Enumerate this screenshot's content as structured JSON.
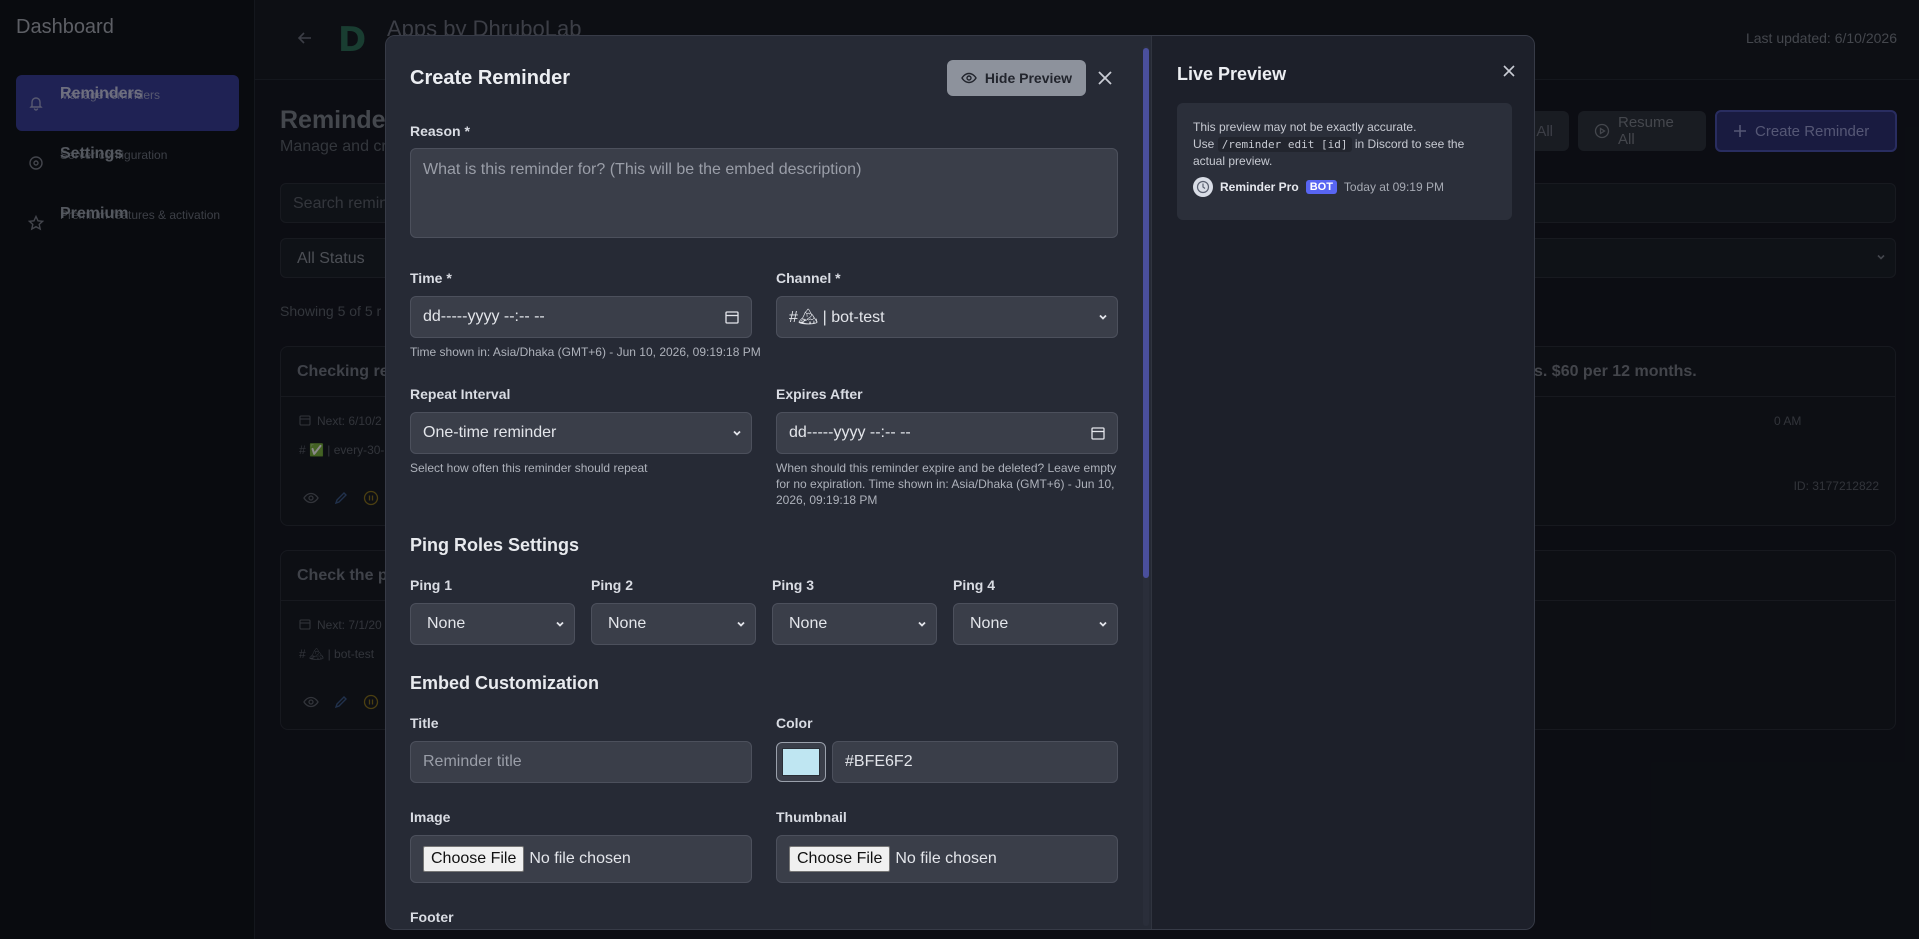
{
  "sidebar": {
    "title": "Dashboard",
    "items": [
      {
        "label": "Reminders",
        "sub": "Manage reminders",
        "icon": "bell-icon"
      },
      {
        "label": "Settings",
        "sub": "Server configuration",
        "icon": "gear-icon"
      },
      {
        "label": "Premium",
        "sub": "Premium features & activation",
        "icon": "star-icon"
      }
    ]
  },
  "header": {
    "logo": "D",
    "title": "Apps by DhruboLab",
    "last_updated": "Last updated: 6/10/2026"
  },
  "page": {
    "title": "Reminder",
    "subtitle": "Manage and cr",
    "search_placeholder": "Search remin",
    "status_filter": "All Status",
    "showing": "Showing 5 of 5 r",
    "buttons": {
      "pause_all": "All",
      "resume_all": "Resume All",
      "create": "Create Reminder"
    }
  },
  "cards": [
    {
      "title": "Checking re",
      "next": "Next: 6/10/2",
      "channel": "# ✅ | every-30-",
      "right_title": "s. $60 per 12 months.",
      "right_time": "0 AM",
      "id": "ID: 3177212822"
    },
    {
      "title": "Check the p",
      "next": "Next: 7/1/20",
      "channel": "# 🏔 | bot-test"
    }
  ],
  "modal": {
    "title": "Create Reminder",
    "hide_preview": "Hide Preview",
    "reason": {
      "label": "Reason *",
      "placeholder": "What is this reminder for? (This will be the embed description)"
    },
    "time": {
      "label": "Time *",
      "value": "dd-----yyyy --:-- --",
      "hint": "Time shown in: Asia/Dhaka (GMT+6) - Jun 10, 2026, 09:19:18 PM"
    },
    "channel": {
      "label": "Channel *",
      "value": "#🏔 | bot-test"
    },
    "repeat": {
      "label": "Repeat Interval",
      "value": "One-time reminder",
      "hint": "Select how often this reminder should repeat"
    },
    "expires": {
      "label": "Expires After",
      "value": "dd-----yyyy --:-- --",
      "hint": "When should this reminder expire and be deleted? Leave empty for no expiration. Time shown in: Asia/Dhaka (GMT+6) - Jun 10, 2026, 09:19:18 PM"
    },
    "ping_section": "Ping Roles Settings",
    "pings": [
      {
        "label": "Ping 1",
        "value": "None"
      },
      {
        "label": "Ping 2",
        "value": "None"
      },
      {
        "label": "Ping 3",
        "value": "None"
      },
      {
        "label": "Ping 4",
        "value": "None"
      }
    ],
    "embed_section": "Embed Customization",
    "embed_title": {
      "label": "Title",
      "placeholder": "Reminder title"
    },
    "color": {
      "label": "Color",
      "value": "#BFE6F2",
      "hex": "#BFE6F2"
    },
    "image": {
      "label": "Image",
      "button": "Choose File",
      "status": "No file chosen"
    },
    "thumbnail": {
      "label": "Thumbnail",
      "button": "Choose File",
      "status": "No file chosen"
    },
    "footer_label": "Footer"
  },
  "preview": {
    "title": "Live Preview",
    "note1": "This preview may not be exactly accurate.",
    "note2_a": "Use",
    "note2_code": "/reminder edit [id]",
    "note2_b": "in Discord to see the",
    "note3": "actual preview.",
    "bot_name": "Reminder Pro",
    "bot_tag": "BOT",
    "time": "Today at 09:19 PM"
  },
  "colors": {
    "accent": "#3a3f9a",
    "bot_badge": "#5865F2"
  }
}
